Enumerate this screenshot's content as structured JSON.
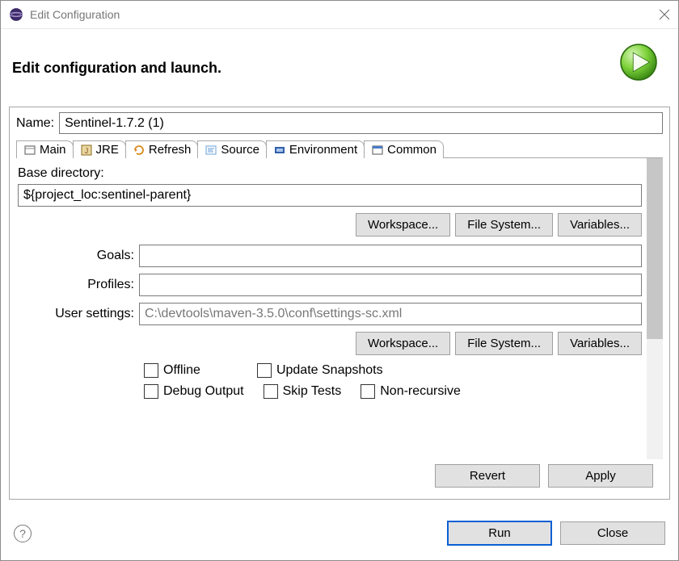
{
  "window": {
    "title": "Edit Configuration"
  },
  "header": {
    "title": "Edit configuration and launch."
  },
  "name": {
    "label": "Name:",
    "value": "Sentinel-1.7.2 (1)"
  },
  "tabs": {
    "main": "Main",
    "jre": "JRE",
    "refresh": "Refresh",
    "source": "Source",
    "environment": "Environment",
    "common": "Common"
  },
  "main": {
    "base_dir_label": "Base directory:",
    "base_dir_value": "${project_loc:sentinel-parent}",
    "goals_label": "Goals:",
    "goals_value": "",
    "profiles_label": "Profiles:",
    "profiles_value": "",
    "user_settings_label": "User settings:",
    "user_settings_value": "C:\\devtools\\maven-3.5.0\\conf\\settings-sc.xml",
    "btn_workspace": "Workspace...",
    "btn_filesystem": "File System...",
    "btn_variables": "Variables...",
    "chk_offline": "Offline",
    "chk_update_snapshots": "Update Snapshots",
    "chk_debug_output": "Debug Output",
    "chk_skip_tests": "Skip Tests",
    "chk_non_recursive": "Non-recursive"
  },
  "actions": {
    "revert": "Revert",
    "apply": "Apply",
    "run": "Run",
    "close": "Close"
  }
}
